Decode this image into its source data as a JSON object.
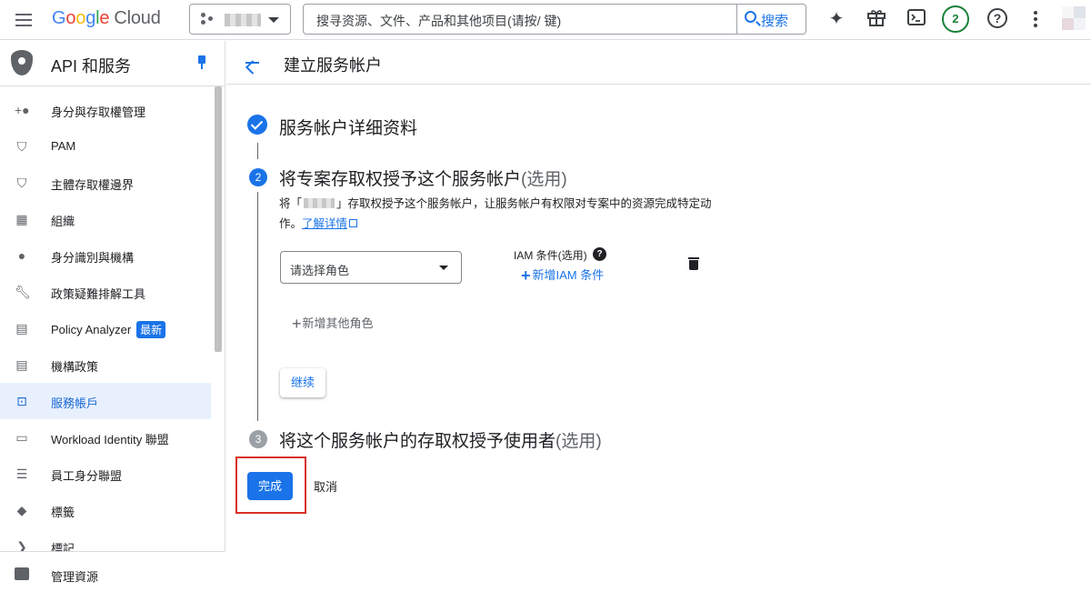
{
  "header": {
    "logo": {
      "g1": "G",
      "g2": "o",
      "g3": "o",
      "g4": "g",
      "g5": "l",
      "g6": "e",
      "cloud": "Cloud"
    },
    "search": {
      "placeholder": "搜寻资源、文件、产品和其他项目(请按/ 键)",
      "button_label": "搜索"
    },
    "notifications_count": "2",
    "icons": [
      "menu-icon",
      "project-icon",
      "gemini-spark-icon",
      "gift-icon",
      "cloud-shell-icon",
      "help-icon",
      "more-vert-icon",
      "avatar"
    ]
  },
  "sidebar": {
    "title": "API 和服务",
    "items": [
      {
        "label": "身分與存取權管理",
        "icon": "person-add-icon"
      },
      {
        "label": "PAM",
        "icon": "shield-icon"
      },
      {
        "label": "主體存取權邊界",
        "icon": "shield-gear-icon"
      },
      {
        "label": "組織",
        "icon": "building-icon"
      },
      {
        "label": "身分識別與機構",
        "icon": "account-circle-icon"
      },
      {
        "label": "政策疑難排解工具",
        "icon": "wrench-icon"
      },
      {
        "label": "Policy Analyzer",
        "badge": "最新",
        "icon": "policy-doc-icon"
      },
      {
        "label": "機構政策",
        "icon": "list-doc-icon"
      },
      {
        "label": "服務帳戶",
        "icon": "service-account-icon",
        "active": true
      },
      {
        "label": "Workload Identity 聯盟",
        "icon": "id-card-icon"
      },
      {
        "label": "員工身分聯盟",
        "icon": "list-icon"
      },
      {
        "label": "標籤",
        "icon": "tag-icon"
      },
      {
        "label": "標記",
        "icon": "label-icon"
      }
    ],
    "bottom_item": "管理資源"
  },
  "main": {
    "title": "建立服务帐户",
    "step1": {
      "title": "服务帐户详细资料"
    },
    "step2": {
      "number": "2",
      "title": "将专案存取权授予这个服务帐户",
      "optional": "(选用)",
      "desc_prefix": "将「",
      "desc_suffix": "」存取权授予这个服务帐户，让服务帐户有权限对专案中的资源完成特定动作。",
      "learn_more": "了解详情",
      "role_placeholder": "请选择角色",
      "iam_condition_label": "IAM 条件(选用)",
      "add_iam_condition": "新增IAM 条件",
      "add_role": "新增其他角色",
      "continue_label": "继续"
    },
    "step3": {
      "number": "3",
      "title": "将这个服务帐户的存取权授予使用者",
      "optional": "(选用)"
    },
    "done_label": "完成",
    "cancel_label": "取消"
  },
  "colors": {
    "accent": "#1a73e8",
    "highlight": "#d93025",
    "notification": "#188038"
  }
}
